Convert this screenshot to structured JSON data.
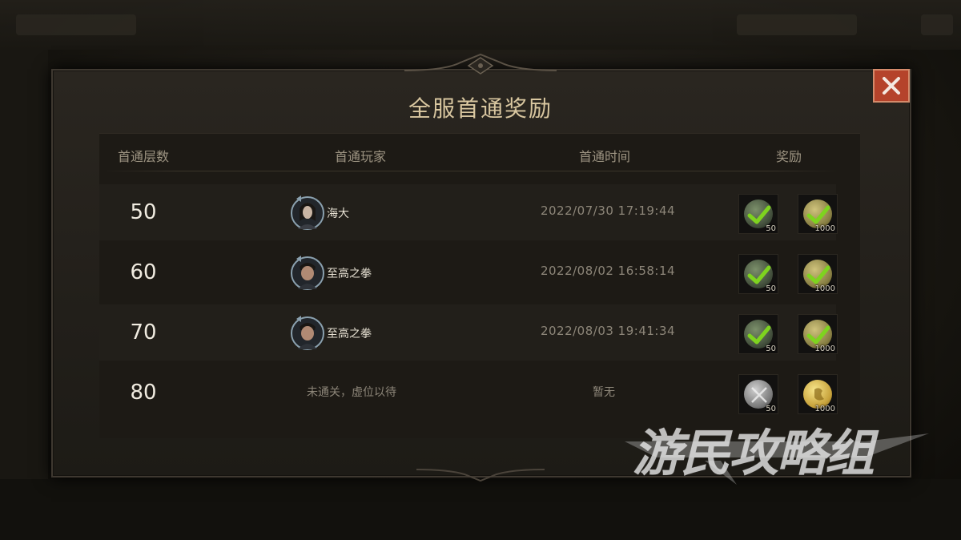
{
  "dialog": {
    "title": "全服首通奖励",
    "close_label": "✕"
  },
  "columns": {
    "floor": "首通层数",
    "player": "首通玩家",
    "time": "首通时间",
    "reward": "奖励"
  },
  "rows": [
    {
      "floor": "50",
      "player": "海大",
      "time": "2022/07/30 17:19:44",
      "rewards": [
        {
          "icon": "green-orb-checked-icon",
          "count": "50"
        },
        {
          "icon": "gold-orb-checked-icon",
          "count": "1000"
        }
      ]
    },
    {
      "floor": "60",
      "player": "至高之拳",
      "time": "2022/08/02 16:58:14",
      "rewards": [
        {
          "icon": "green-orb-checked-icon",
          "count": "50"
        },
        {
          "icon": "gold-orb-checked-icon",
          "count": "1000"
        }
      ]
    },
    {
      "floor": "70",
      "player": "至高之拳",
      "time": "2022/08/03 19:41:34",
      "rewards": [
        {
          "icon": "green-orb-checked-icon",
          "count": "50"
        },
        {
          "icon": "gold-orb-checked-icon",
          "count": "1000"
        }
      ]
    },
    {
      "floor": "80",
      "player": "未通关，虚位以待",
      "time": "暂无",
      "rewards": [
        {
          "icon": "silver-orb-icon",
          "count": "50"
        },
        {
          "icon": "gold-orb-icon",
          "count": "1000"
        }
      ]
    }
  ],
  "watermark": {
    "text": "游民攻略组"
  },
  "colors": {
    "title": "#d9c7a0",
    "close_button": "#b5432b",
    "check": "#7ed31f"
  }
}
